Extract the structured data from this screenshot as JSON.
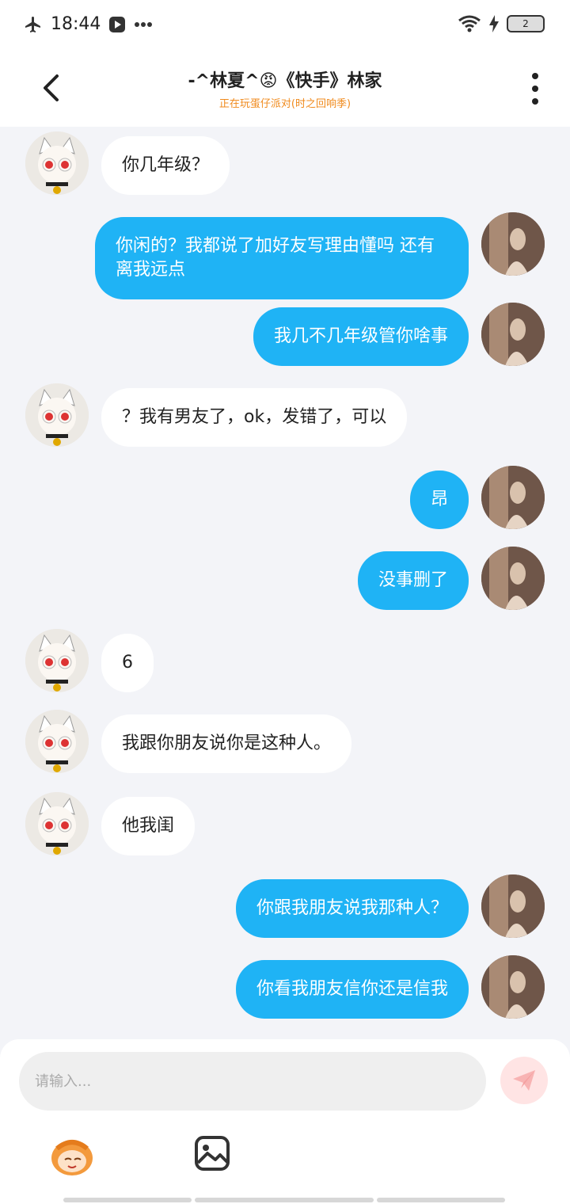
{
  "status_bar": {
    "time": "18:44",
    "battery": "2"
  },
  "header": {
    "title": "-^林夏^😡《快手》林家",
    "subtitle": "正在玩蛋仔派对(时之回响季)"
  },
  "messages": [
    {
      "side": "left",
      "text": "你几年级？"
    },
    {
      "side": "right",
      "text": "你闲的？我都说了加好友写理由懂吗 还有离我远点"
    },
    {
      "side": "right",
      "text": "我几不几年级管你啥事"
    },
    {
      "side": "left",
      "text": "？我有男友了，ok，发错了，可以"
    },
    {
      "side": "right",
      "text": "昂"
    },
    {
      "side": "right",
      "text": "没事删了"
    },
    {
      "side": "left",
      "text": "6"
    },
    {
      "side": "left",
      "text": "我跟你朋友说你是这种人。"
    },
    {
      "side": "left",
      "text": "他我闺"
    },
    {
      "side": "right",
      "text": "你跟我朋友说我那种人？"
    },
    {
      "side": "right",
      "text": "你看我朋友信你还是信我"
    }
  ],
  "composer": {
    "placeholder": "请输入..."
  },
  "colors": {
    "accent": "#1fb3f5",
    "subtitle": "#f08a1c"
  }
}
